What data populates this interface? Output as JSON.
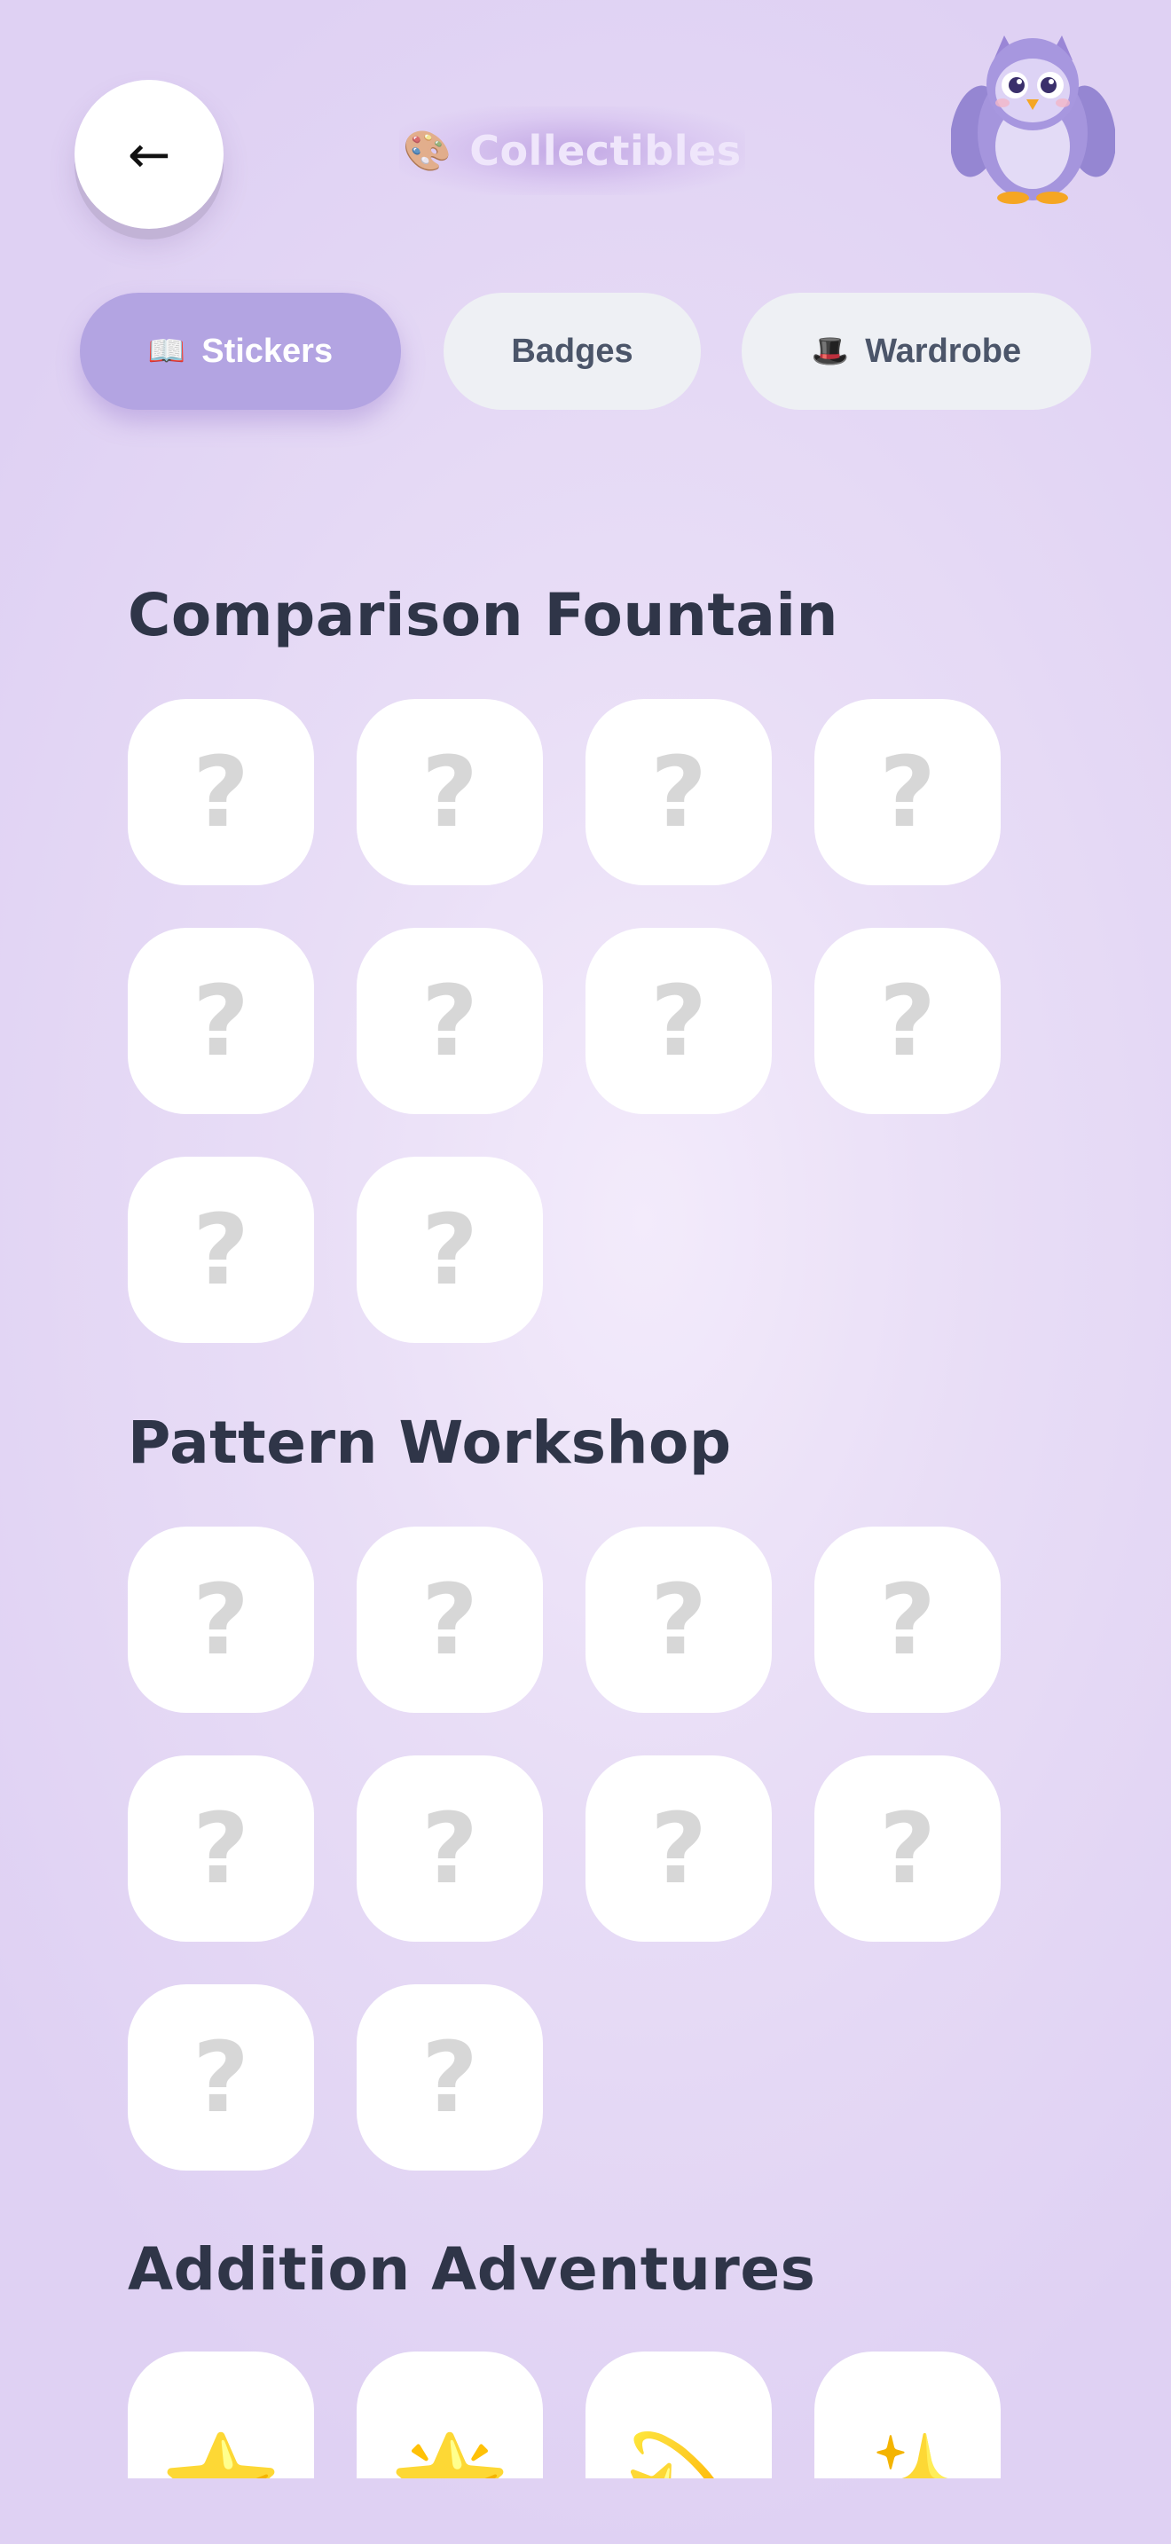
{
  "header": {
    "back_label": "←",
    "title_icon": "🎨",
    "title": "Collectibles",
    "mascot": "owl-mascot"
  },
  "tabs": [
    {
      "icon": "📖",
      "label": "Stickers",
      "active": true
    },
    {
      "icon": "",
      "label": "Badges",
      "active": false
    },
    {
      "icon": "🎩",
      "label": "Wardrobe",
      "active": false
    }
  ],
  "sections": [
    {
      "title": "Comparison Fountain",
      "tiles": [
        "?",
        "?",
        "?",
        "?",
        "?",
        "?",
        "?",
        "?",
        "?",
        "?"
      ]
    },
    {
      "title": "Pattern Workshop",
      "tiles": [
        "?",
        "?",
        "?",
        "?",
        "?",
        "?",
        "?",
        "?",
        "?",
        "?"
      ]
    },
    {
      "title": "Addition Adventures",
      "tiles": [
        "⭐",
        "🌟",
        "💫",
        "✨"
      ]
    }
  ],
  "colors": {
    "accent": "#b3a4e2",
    "tab_inactive_bg": "#eef0f4",
    "heading": "#2f3548",
    "locked_glyph": "#d7d7d7"
  }
}
